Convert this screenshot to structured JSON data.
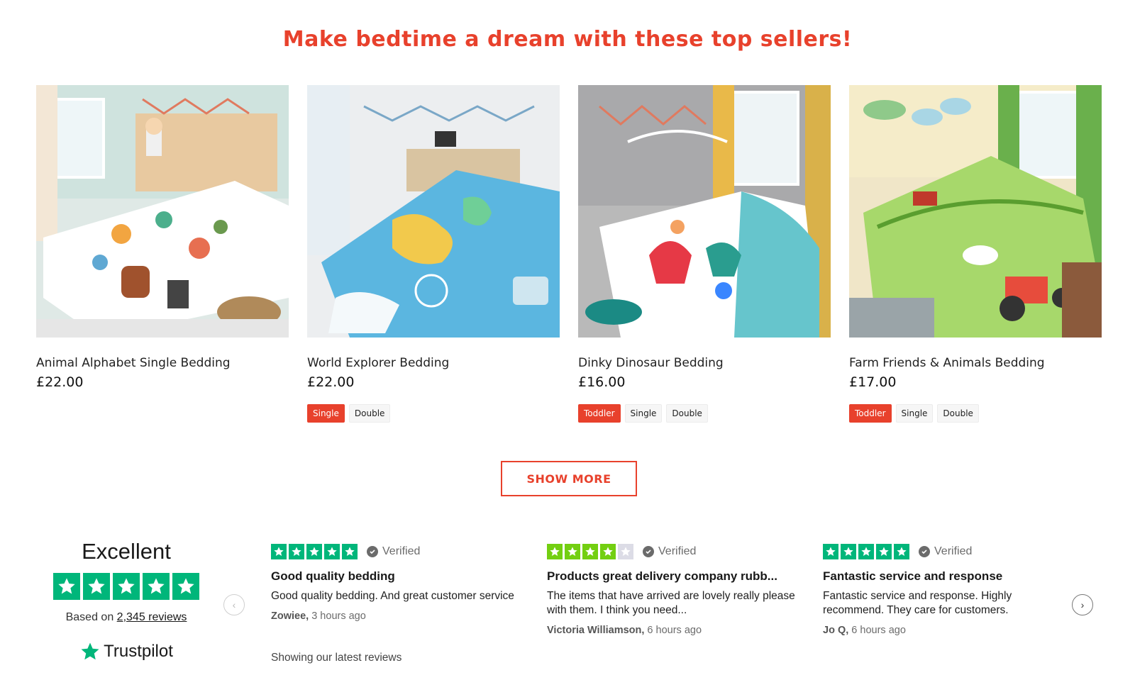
{
  "headline": "Make bedtime a dream with these top sellers!",
  "products": [
    {
      "title": "Animal Alphabet Single Bedding",
      "price": "£22.00",
      "sizes": []
    },
    {
      "title": "World Explorer Bedding",
      "price": "£22.00",
      "sizes": [
        {
          "label": "Single",
          "active": true
        },
        {
          "label": "Double",
          "active": false
        }
      ]
    },
    {
      "title": "Dinky Dinosaur Bedding",
      "price": "£16.00",
      "sizes": [
        {
          "label": "Toddler",
          "active": true
        },
        {
          "label": "Single",
          "active": false
        },
        {
          "label": "Double",
          "active": false
        }
      ]
    },
    {
      "title": "Farm Friends & Animals Bedding",
      "price": "£17.00",
      "sizes": [
        {
          "label": "Toddler",
          "active": true
        },
        {
          "label": "Single",
          "active": false
        },
        {
          "label": "Double",
          "active": false
        }
      ]
    }
  ],
  "show_more_label": "SHOW MORE",
  "trustpilot": {
    "rating_word": "Excellent",
    "based_on_prefix": "Based on",
    "reviews_link": "2,345 reviews",
    "brand": "Trustpilot",
    "latest_note": "Showing our latest reviews",
    "star_color": "#00b67a",
    "star_color_partial": "#73cf11"
  },
  "reviews": [
    {
      "stars": 5,
      "verified": "Verified",
      "title": "Good quality bedding",
      "body": "Good quality bedding. And great customer service",
      "author": "Zowiee,",
      "time": "3 hours ago"
    },
    {
      "stars": 4,
      "verified": "Verified",
      "title": "Products great delivery company rubb...",
      "body": "The items that have arrived are lovely really please with them. I think you need...",
      "author": "Victoria Williamson,",
      "time": "6 hours ago"
    },
    {
      "stars": 5,
      "verified": "Verified",
      "title": "Fantastic service and response",
      "body": "Fantastic service and response. Highly recommend. They care for customers.",
      "author": "Jo Q,",
      "time": "6 hours ago"
    }
  ],
  "colors": {
    "accent": "#e8412c"
  }
}
